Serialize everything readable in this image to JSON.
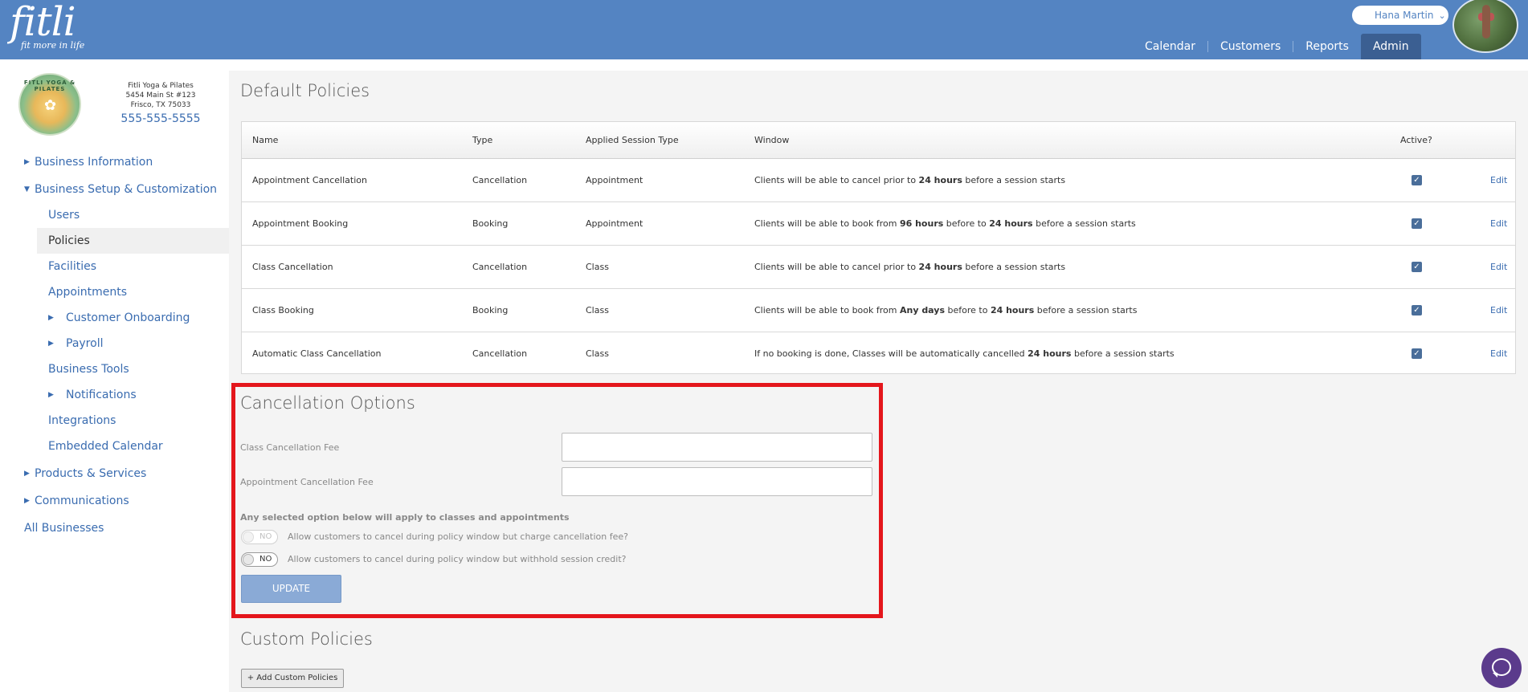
{
  "brand": {
    "logo_text": "fitli",
    "tagline": "fit more in life"
  },
  "user": {
    "name": "Hana Martin",
    "chevron": "⌄"
  },
  "topnav": {
    "items": [
      {
        "label": "Calendar"
      },
      {
        "label": "Customers"
      },
      {
        "label": "Reports"
      },
      {
        "label": "Admin",
        "active": true
      }
    ]
  },
  "business": {
    "logo_text": "FITLI YOGA & PILATES",
    "name": "Fitli Yoga & Pilates",
    "address1": "5454 Main St #123",
    "address2": "Frisco, TX 75033",
    "phone": "555-555-5555"
  },
  "sidebar": {
    "items": [
      {
        "label": "Business Information",
        "caret": "▶"
      },
      {
        "label": "Business Setup & Customization",
        "caret": "▼"
      },
      {
        "label": "Users"
      },
      {
        "label": "Policies",
        "active": true
      },
      {
        "label": "Facilities"
      },
      {
        "label": "Appointments"
      },
      {
        "label": "Customer Onboarding",
        "caret": "▶"
      },
      {
        "label": "Payroll",
        "caret": "▶"
      },
      {
        "label": "Business Tools"
      },
      {
        "label": "Notifications",
        "caret": "▶"
      },
      {
        "label": "Integrations"
      },
      {
        "label": "Embedded Calendar"
      },
      {
        "label": "Products & Services",
        "caret": "▶"
      },
      {
        "label": "Communications",
        "caret": "▶"
      },
      {
        "label": "All Businesses"
      }
    ]
  },
  "default_policies": {
    "title": "Default Policies",
    "columns": [
      "Name",
      "Type",
      "Applied Session Type",
      "Window",
      "Active?"
    ],
    "edit_label": "Edit",
    "rows": [
      {
        "name": "Appointment Cancellation",
        "type": "Cancellation",
        "session": "Appointment",
        "w1": "Clients will be able to cancel prior to ",
        "b1": "24 hours",
        "w2": " before a session starts",
        "b2": "",
        "w3": "",
        "active": true
      },
      {
        "name": "Appointment Booking",
        "type": "Booking",
        "session": "Appointment",
        "w1": "Clients will be able to book from ",
        "b1": "96 hours",
        "w2": " before to ",
        "b2": "24 hours",
        "w3": " before a session starts",
        "active": true
      },
      {
        "name": "Class Cancellation",
        "type": "Cancellation",
        "session": "Class",
        "w1": "Clients will be able to cancel prior to ",
        "b1": "24 hours",
        "w2": " before a session starts",
        "b2": "",
        "w3": "",
        "active": true
      },
      {
        "name": "Class Booking",
        "type": "Booking",
        "session": "Class",
        "w1": "Clients will be able to book from ",
        "b1": "Any days",
        "w2": " before to ",
        "b2": "24 hours",
        "w3": " before a session starts",
        "active": true
      },
      {
        "name": "Automatic Class Cancellation",
        "type": "Cancellation",
        "session": "Class",
        "w1": "If no booking is done, Classes will be automatically cancelled ",
        "b1": "24 hours",
        "w2": " before a session starts",
        "b2": "",
        "w3": "",
        "active": true
      }
    ]
  },
  "cancellation_options": {
    "title": "Cancellation Options",
    "class_fee_label": "Class Cancellation Fee",
    "class_fee_value": "",
    "appt_fee_label": "Appointment Cancellation Fee",
    "appt_fee_value": "",
    "note": "Any selected option below will apply to classes and appointments",
    "toggle1": {
      "state": "NO",
      "text": "Allow customers to cancel during policy window but charge cancellation fee?",
      "disabled": true
    },
    "toggle2": {
      "state": "NO",
      "text": "Allow customers to cancel during policy window but withhold session credit?",
      "disabled": false
    },
    "update_label": "UPDATE"
  },
  "custom_policies": {
    "title": "Custom Policies",
    "add_label": "+ Add Custom Policies"
  },
  "colors": {
    "header": "#5484c2",
    "link": "#3a6cb0",
    "highlight": "#e4161c",
    "chat": "#5b3b8c"
  }
}
